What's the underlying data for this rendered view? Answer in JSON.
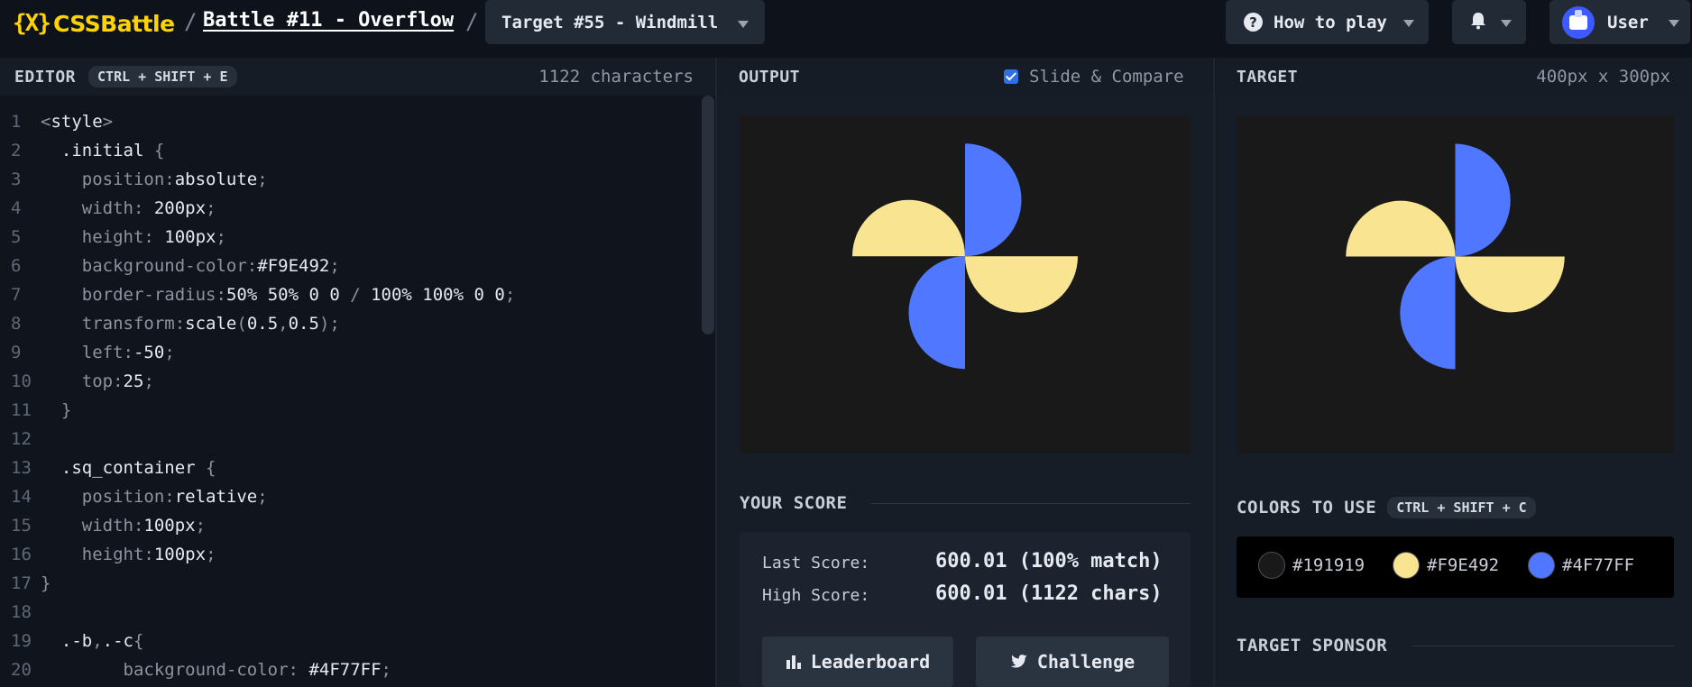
{
  "header": {
    "logo_mark": "{X}",
    "logo_text": "CSSBattle",
    "separator": "/",
    "battle_link": "Battle #11 - Overflow",
    "target_select": "Target #55 - Windmill",
    "how_to_play": "How to play",
    "user_label": "User"
  },
  "editor": {
    "title": "EDITOR",
    "shortcut": "CTRL + SHIFT + E",
    "char_count": "1122 characters",
    "lines": [
      {
        "n": "1",
        "text": "<style>"
      },
      {
        "n": "2",
        "text": "  .initial {"
      },
      {
        "n": "3",
        "text": "    position:absolute;"
      },
      {
        "n": "4",
        "text": "    width: 200px;"
      },
      {
        "n": "5",
        "text": "    height: 100px;"
      },
      {
        "n": "6",
        "text": "    background-color:#F9E492;"
      },
      {
        "n": "7",
        "text": "    border-radius:50% 50% 0 0 / 100% 100% 0 0;"
      },
      {
        "n": "8",
        "text": "    transform:scale(0.5,0.5);"
      },
      {
        "n": "9",
        "text": "    left:-50;"
      },
      {
        "n": "10",
        "text": "    top:25;"
      },
      {
        "n": "11",
        "text": "  }"
      },
      {
        "n": "12",
        "text": ""
      },
      {
        "n": "13",
        "text": "  .sq_container {"
      },
      {
        "n": "14",
        "text": "    position:relative;"
      },
      {
        "n": "15",
        "text": "    width:100px;"
      },
      {
        "n": "16",
        "text": "    height:100px;"
      },
      {
        "n": "17",
        "text": "}"
      },
      {
        "n": "18",
        "text": ""
      },
      {
        "n": "19",
        "text": "  .-b,.-c{"
      },
      {
        "n": "20",
        "text": "        background-color: #4F77FF;"
      }
    ]
  },
  "output": {
    "title": "OUTPUT",
    "slide_compare": "Slide & Compare",
    "slide_compare_checked": true
  },
  "target": {
    "title": "TARGET",
    "size": "400px x 300px"
  },
  "score": {
    "title": "YOUR SCORE",
    "last_label": "Last Score:",
    "last_value": "600.01 (100% match)",
    "high_label": "High Score:",
    "high_value": "600.01 (1122 chars)",
    "leaderboard_button": "Leaderboard",
    "challenge_button": "Challenge"
  },
  "colors": {
    "title": "COLORS TO USE",
    "shortcut": "CTRL + SHIFT + C",
    "swatches": [
      {
        "hex": "#191919",
        "label": "#191919"
      },
      {
        "hex": "#F9E492",
        "label": "#F9E492"
      },
      {
        "hex": "#4F77FF",
        "label": "#4F77FF"
      }
    ]
  },
  "sponsor": {
    "title": "TARGET SPONSOR"
  },
  "palette": {
    "accent_yellow": "#ffd300",
    "canvas_bg": "#191919",
    "shape_yellow": "#F9E492",
    "shape_blue": "#4F77FF"
  },
  "icons": {
    "how_to_play": "question-circle-icon",
    "notifications": "bell-icon",
    "leaderboard": "bar-chart-icon",
    "challenge": "twitter-icon",
    "dropdown": "chevron-down-icon"
  }
}
